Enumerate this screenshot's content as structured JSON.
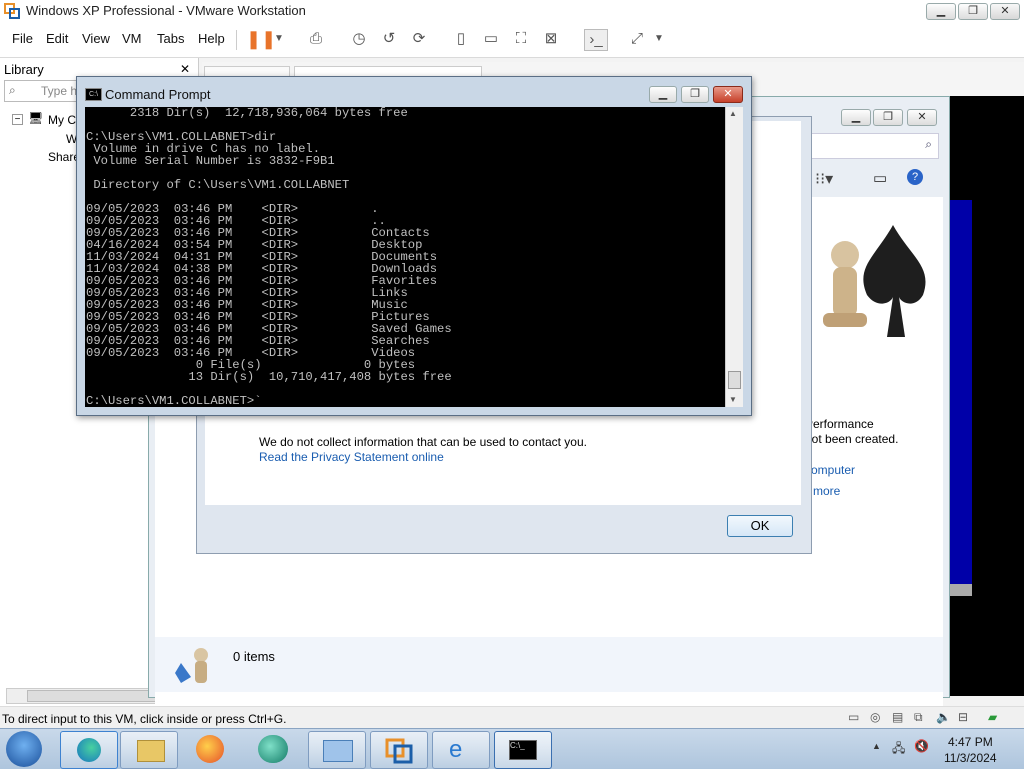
{
  "window": {
    "title": "Windows XP Professional - VMware Workstation",
    "minimize": "▁",
    "maximize": "❐",
    "close": "✕"
  },
  "menu": [
    "File",
    "Edit",
    "View",
    "VM",
    "Tabs",
    "Help"
  ],
  "library": {
    "title": "Library",
    "close": "✕",
    "search_placeholder": "Type h",
    "tree": [
      "My C",
      "W",
      "Share"
    ]
  },
  "explorer": {
    "item_count": "0 items",
    "perf_line1": "Performance",
    "perf_line2": "not been created.",
    "link_computer": "computer",
    "link_more": "more"
  },
  "dialog": {
    "privacy_text": "We do not collect information that can be used to contact you.",
    "privacy_link": "Read the Privacy Statement online",
    "ok_label": "OK"
  },
  "cmd": {
    "title": "Command Prompt",
    "output": "      2318 Dir(s)  12,718,936,064 bytes free\n\nC:\\Users\\VM1.COLLABNET>dir\n Volume in drive C has no label.\n Volume Serial Number is 3832-F9B1\n\n Directory of C:\\Users\\VM1.COLLABNET\n\n09/05/2023  03:46 PM    <DIR>          .\n09/05/2023  03:46 PM    <DIR>          ..\n09/05/2023  03:46 PM    <DIR>          Contacts\n04/16/2024  03:54 PM    <DIR>          Desktop\n11/03/2024  04:31 PM    <DIR>          Documents\n11/03/2024  04:38 PM    <DIR>          Downloads\n09/05/2023  03:46 PM    <DIR>          Favorites\n09/05/2023  03:46 PM    <DIR>          Links\n09/05/2023  03:46 PM    <DIR>          Music\n09/05/2023  03:46 PM    <DIR>          Pictures\n09/05/2023  03:46 PM    <DIR>          Saved Games\n09/05/2023  03:46 PM    <DIR>          Searches\n09/05/2023  03:46 PM    <DIR>          Videos\n               0 File(s)              0 bytes\n              13 Dir(s)  10,710,417,408 bytes free\n\nC:\\Users\\VM1.COLLABNET>`"
  },
  "status": {
    "text": "To direct input to this VM, click inside or press Ctrl+G."
  },
  "taskbar": {
    "time": "4:47 PM",
    "date": "11/3/2024"
  }
}
